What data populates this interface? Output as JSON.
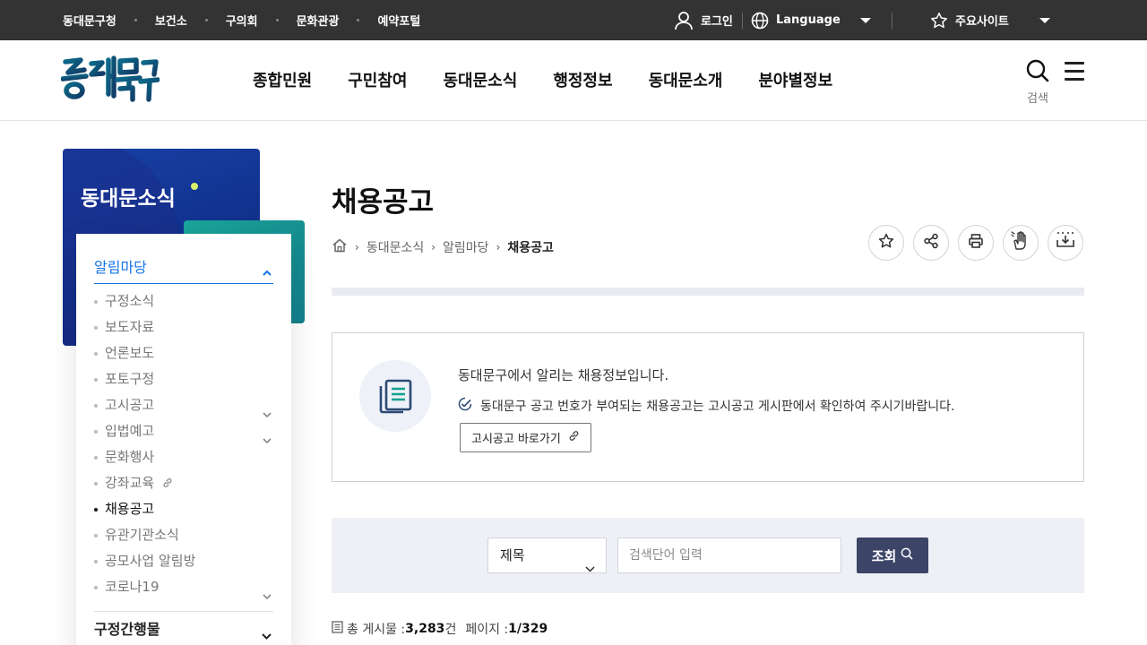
{
  "topbar": {
    "links": [
      "동대문구청",
      "보건소",
      "구의회",
      "문화관광",
      "예약포털"
    ],
    "login": "로그인",
    "language": "Language",
    "sites": "주요사이트"
  },
  "header": {
    "logo_text": "동대문구",
    "nav": [
      "종합민원",
      "구민참여",
      "동대문소식",
      "행정정보",
      "동대문소개",
      "분야별정보"
    ],
    "search_label": "검색"
  },
  "sidebar": {
    "title": "동대문소식",
    "section": "알림마당",
    "items": [
      {
        "label": "구정소식"
      },
      {
        "label": "보도자료"
      },
      {
        "label": "언론보도"
      },
      {
        "label": "포토구정"
      },
      {
        "label": "고시공고",
        "expand": true
      },
      {
        "label": "입법예고",
        "expand": true
      },
      {
        "label": "문화행사"
      },
      {
        "label": "강좌교육",
        "external": true
      },
      {
        "label": "채용공고",
        "active": true
      },
      {
        "label": "유관기관소식"
      },
      {
        "label": "공모사업 알림방"
      },
      {
        "label": "코로나19",
        "expand": true
      }
    ],
    "footer_section": "구정간행물"
  },
  "main": {
    "title": "채용공고",
    "breadcrumb": [
      "동대문소식",
      "알림마당",
      "채용공고"
    ],
    "info": {
      "headline": "동대문구에서 알리는 채용정보입니다.",
      "note": "동대문구 공고 번호가 부여되는 채용공고는 고시공고 게시판에서 확인하여 주시기바랍니다.",
      "button": "고시공고 바로가기"
    },
    "search": {
      "select_value": "제목",
      "placeholder": "검색단어 입력",
      "button": "조회"
    },
    "count": {
      "total_label": "총 게시물 : ",
      "total_value": "3,283",
      "total_unit": "건",
      "page_label": "페이지 : ",
      "page_value": "1/329"
    }
  },
  "colors": {
    "topbar_bg": "#333333",
    "accent_blue": "#1673e6",
    "side_navy": "#10308a",
    "side_teal": "#1aa69a",
    "search_button": "#3c4468"
  }
}
